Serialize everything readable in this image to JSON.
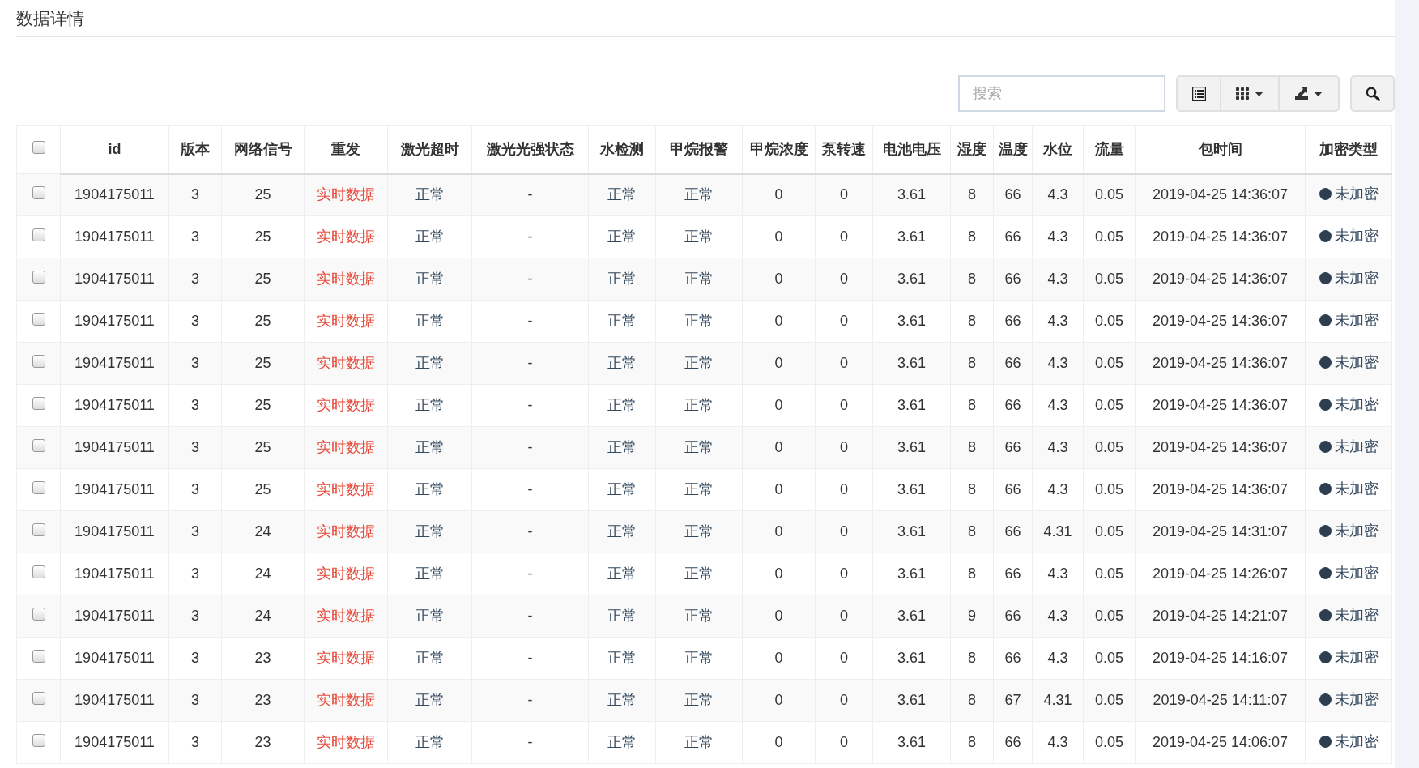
{
  "title": "数据详情",
  "toolbar": {
    "search": {
      "placeholder": "搜索"
    }
  },
  "table": {
    "select_all": {
      "checked": false
    },
    "columns": [
      {
        "label": "id",
        "kind": "plain"
      },
      {
        "label": "版本",
        "kind": "plain"
      },
      {
        "label": "网络信号",
        "kind": "plain"
      },
      {
        "label": "重发",
        "kind": "alert"
      },
      {
        "label": "激光超时",
        "kind": "status"
      },
      {
        "label": "激光光强状态",
        "kind": "plain"
      },
      {
        "label": "水检测",
        "kind": "status"
      },
      {
        "label": "甲烷报警",
        "kind": "status"
      },
      {
        "label": "甲烷浓度",
        "kind": "plain"
      },
      {
        "label": "泵转速",
        "kind": "plain"
      },
      {
        "label": "电池电压",
        "kind": "plain"
      },
      {
        "label": "湿度",
        "kind": "plain"
      },
      {
        "label": "温度",
        "kind": "plain"
      },
      {
        "label": "水位",
        "kind": "plain"
      },
      {
        "label": "流量",
        "kind": "plain"
      },
      {
        "label": "包时间",
        "kind": "plain"
      },
      {
        "label": "加密类型",
        "kind": "dot"
      }
    ],
    "rows": [
      {
        "checked": false,
        "cells": [
          "1904175011",
          "3",
          "25",
          "实时数据",
          "正常",
          "-",
          "正常",
          "正常",
          "0",
          "0",
          "3.61",
          "8",
          "66",
          "4.3",
          "0.05",
          "2019-04-25 14:36:07",
          "未加密"
        ]
      },
      {
        "checked": false,
        "cells": [
          "1904175011",
          "3",
          "25",
          "实时数据",
          "正常",
          "-",
          "正常",
          "正常",
          "0",
          "0",
          "3.61",
          "8",
          "66",
          "4.3",
          "0.05",
          "2019-04-25 14:36:07",
          "未加密"
        ]
      },
      {
        "checked": false,
        "cells": [
          "1904175011",
          "3",
          "25",
          "实时数据",
          "正常",
          "-",
          "正常",
          "正常",
          "0",
          "0",
          "3.61",
          "8",
          "66",
          "4.3",
          "0.05",
          "2019-04-25 14:36:07",
          "未加密"
        ]
      },
      {
        "checked": false,
        "cells": [
          "1904175011",
          "3",
          "25",
          "实时数据",
          "正常",
          "-",
          "正常",
          "正常",
          "0",
          "0",
          "3.61",
          "8",
          "66",
          "4.3",
          "0.05",
          "2019-04-25 14:36:07",
          "未加密"
        ]
      },
      {
        "checked": false,
        "cells": [
          "1904175011",
          "3",
          "25",
          "实时数据",
          "正常",
          "-",
          "正常",
          "正常",
          "0",
          "0",
          "3.61",
          "8",
          "66",
          "4.3",
          "0.05",
          "2019-04-25 14:36:07",
          "未加密"
        ]
      },
      {
        "checked": false,
        "cells": [
          "1904175011",
          "3",
          "25",
          "实时数据",
          "正常",
          "-",
          "正常",
          "正常",
          "0",
          "0",
          "3.61",
          "8",
          "66",
          "4.3",
          "0.05",
          "2019-04-25 14:36:07",
          "未加密"
        ]
      },
      {
        "checked": false,
        "cells": [
          "1904175011",
          "3",
          "25",
          "实时数据",
          "正常",
          "-",
          "正常",
          "正常",
          "0",
          "0",
          "3.61",
          "8",
          "66",
          "4.3",
          "0.05",
          "2019-04-25 14:36:07",
          "未加密"
        ]
      },
      {
        "checked": false,
        "cells": [
          "1904175011",
          "3",
          "25",
          "实时数据",
          "正常",
          "-",
          "正常",
          "正常",
          "0",
          "0",
          "3.61",
          "8",
          "66",
          "4.3",
          "0.05",
          "2019-04-25 14:36:07",
          "未加密"
        ]
      },
      {
        "checked": false,
        "cells": [
          "1904175011",
          "3",
          "24",
          "实时数据",
          "正常",
          "-",
          "正常",
          "正常",
          "0",
          "0",
          "3.61",
          "8",
          "66",
          "4.31",
          "0.05",
          "2019-04-25 14:31:07",
          "未加密"
        ]
      },
      {
        "checked": false,
        "cells": [
          "1904175011",
          "3",
          "24",
          "实时数据",
          "正常",
          "-",
          "正常",
          "正常",
          "0",
          "0",
          "3.61",
          "8",
          "66",
          "4.3",
          "0.05",
          "2019-04-25 14:26:07",
          "未加密"
        ]
      },
      {
        "checked": false,
        "cells": [
          "1904175011",
          "3",
          "24",
          "实时数据",
          "正常",
          "-",
          "正常",
          "正常",
          "0",
          "0",
          "3.61",
          "9",
          "66",
          "4.3",
          "0.05",
          "2019-04-25 14:21:07",
          "未加密"
        ]
      },
      {
        "checked": false,
        "cells": [
          "1904175011",
          "3",
          "23",
          "实时数据",
          "正常",
          "-",
          "正常",
          "正常",
          "0",
          "0",
          "3.61",
          "8",
          "66",
          "4.3",
          "0.05",
          "2019-04-25 14:16:07",
          "未加密"
        ]
      },
      {
        "checked": false,
        "cells": [
          "1904175011",
          "3",
          "23",
          "实时数据",
          "正常",
          "-",
          "正常",
          "正常",
          "0",
          "0",
          "3.61",
          "8",
          "67",
          "4.31",
          "0.05",
          "2019-04-25 14:11:07",
          "未加密"
        ]
      },
      {
        "checked": false,
        "cells": [
          "1904175011",
          "3",
          "23",
          "实时数据",
          "正常",
          "-",
          "正常",
          "正常",
          "0",
          "0",
          "3.61",
          "8",
          "66",
          "4.3",
          "0.05",
          "2019-04-25 14:06:07",
          "未加密"
        ]
      }
    ]
  }
}
